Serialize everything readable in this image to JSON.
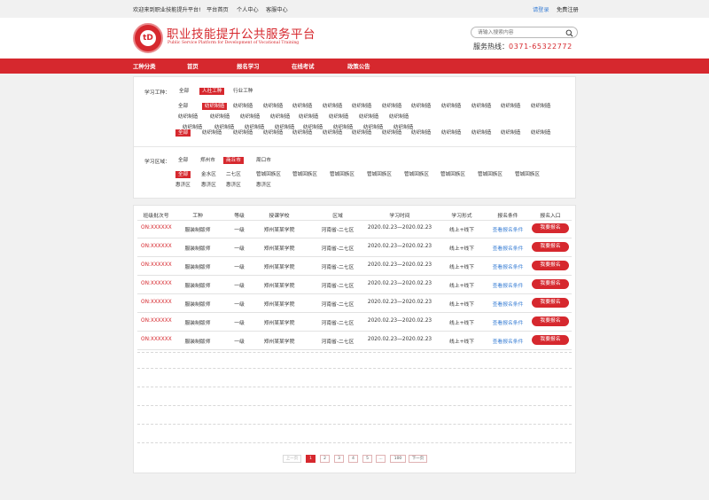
{
  "topbar": {
    "welcome": "欢迎来到职业技能提升平台!",
    "links": [
      "平台首页",
      "个人中心",
      "客服中心"
    ],
    "login": "请登录",
    "register": "免费注册"
  },
  "header": {
    "title": "职业技能提升公共服务平台",
    "subtitle": "Public Service Platform for Development of Vocational Training",
    "search_placeholder": "请输入搜索内容",
    "hotline_label": "服务热线：",
    "hotline_number": "0371-65322772"
  },
  "nav": {
    "items": [
      "工种分类",
      "首页",
      "报名学习",
      "在线考试",
      "政策公告"
    ]
  },
  "filters": {
    "trade": {
      "label": "学习工种：",
      "tabs": [
        "全部",
        "人社工种",
        "行业工种"
      ],
      "sub_all": "全部",
      "sub_items": [
        "纺织制造",
        "纺织制造",
        "纺织制造",
        "纺织制造",
        "纺织制造",
        "纺织制造",
        "纺织制造",
        "纺织制造",
        "纺织制造",
        "纺织制造",
        "纺织制造",
        "纺织制造",
        "纺织制造",
        "纺织制造",
        "纺织制造",
        "纺织制造",
        "纺织制造",
        "纺织制造",
        "纺织制造",
        "纺织制造",
        "纺织制造",
        "纺织制造",
        "纺织制造",
        "纺织制造",
        "纺织制造",
        "纺织制造",
        "纺织制造",
        "纺织制造"
      ],
      "level_all": "全部",
      "level_items": [
        "纺织制造",
        "纺织制造",
        "纺织制造",
        "纺织制造",
        "纺织制造",
        "纺织制造",
        "纺织制造",
        "纺织制造",
        "纺织制造",
        "纺织制造",
        "纺织制造",
        "纺织制造"
      ]
    },
    "region": {
      "label": "学习区域：",
      "cities": [
        "全部",
        "郑州市",
        "商丘市",
        "周口市"
      ],
      "district_all": "全部",
      "districts": [
        "金水区",
        "二七区",
        "管城回族区",
        "管城回族区",
        "管城回族区",
        "管城回族区",
        "管城回族区",
        "管城回族区",
        "管城回族区",
        "管城回族区",
        "惠济区",
        "惠济区",
        "惠济区",
        "惠济区"
      ]
    }
  },
  "table": {
    "headers": [
      "班级批次号",
      "工种",
      "等级",
      "授课学校",
      "区域",
      "学习时间",
      "学习形式",
      "报名条件",
      "报名入口"
    ],
    "rows": [
      {
        "code": "ON:XXXXXX",
        "trade": "服装制版师",
        "level": "一级",
        "school": "郑州某某学院",
        "region": "河南省-二七区",
        "time": "2020.02.23—2020.02.23",
        "form": "线上+线下",
        "cond": "查看报名条件",
        "action": "我要报名"
      },
      {
        "code": "ON:XXXXXX",
        "trade": "服装制版师",
        "level": "一级",
        "school": "郑州某某学院",
        "region": "河南省-二七区",
        "time": "2020.02.23—2020.02.23",
        "form": "线上+线下",
        "cond": "查看报名条件",
        "action": "我要报名"
      },
      {
        "code": "ON:XXXXXX",
        "trade": "服装制版师",
        "level": "一级",
        "school": "郑州某某学院",
        "region": "河南省-二七区",
        "time": "2020.02.23—2020.02.23",
        "form": "线上+线下",
        "cond": "查看报名条件",
        "action": "我要报名"
      },
      {
        "code": "ON:XXXXXX",
        "trade": "服装制版师",
        "level": "一级",
        "school": "郑州某某学院",
        "region": "河南省-二七区",
        "time": "2020.02.23—2020.02.23",
        "form": "线上+线下",
        "cond": "查看报名条件",
        "action": "我要报名"
      },
      {
        "code": "ON:XXXXXX",
        "trade": "服装制版师",
        "level": "一级",
        "school": "郑州某某学院",
        "region": "河南省-二七区",
        "time": "2020.02.23—2020.02.23",
        "form": "线上+线下",
        "cond": "查看报名条件",
        "action": "我要报名"
      },
      {
        "code": "ON:XXXXXX",
        "trade": "服装制版师",
        "level": "一级",
        "school": "郑州某某学院",
        "region": "河南省-二七区",
        "time": "2020.02.23—2020.02.23",
        "form": "线上+线下",
        "cond": "查看报名条件",
        "action": "我要报名"
      },
      {
        "code": "ON:XXXXXX",
        "trade": "服装制版师",
        "level": "一级",
        "school": "郑州某某学院",
        "region": "河南省-二七区",
        "time": "2020.02.23—2020.02.23",
        "form": "线上+线下",
        "cond": "查看报名条件",
        "action": "我要报名"
      }
    ]
  },
  "pagination": {
    "prev": "上一页",
    "pages": [
      "1",
      "2",
      "3",
      "4",
      "5",
      "...",
      "100"
    ],
    "next": "下一页"
  }
}
